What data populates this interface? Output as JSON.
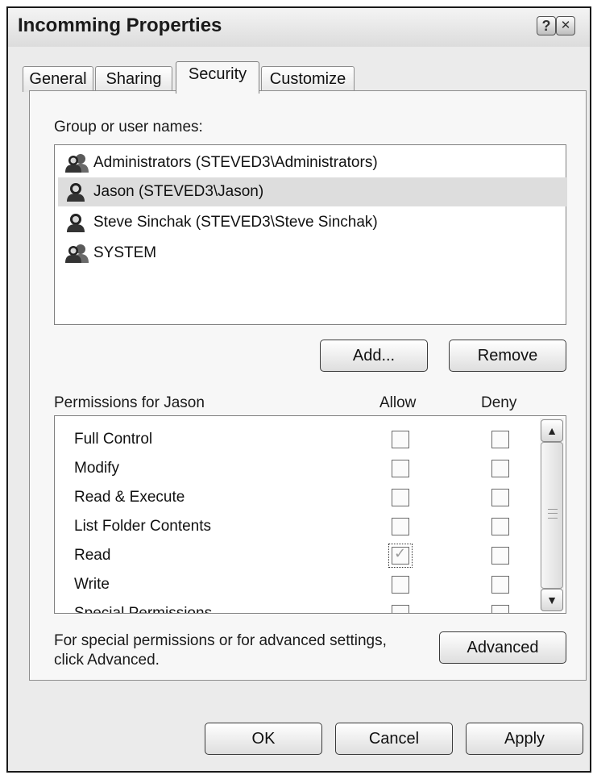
{
  "window": {
    "title": "Incomming Properties",
    "help_glyph": "?",
    "close_glyph": "✕"
  },
  "tabs": [
    {
      "label": "General"
    },
    {
      "label": "Sharing"
    },
    {
      "label": "Security"
    },
    {
      "label": "Customize"
    }
  ],
  "security": {
    "group_label": "Group or user names:",
    "users": [
      {
        "name": "Administrators (STEVED3\\Administrators)",
        "icon": "group-users-icon"
      },
      {
        "name": "Jason (STEVED3\\Jason)",
        "icon": "user-icon",
        "selected": true
      },
      {
        "name": "Steve Sinchak (STEVED3\\Steve Sinchak)",
        "icon": "user-icon"
      },
      {
        "name": "SYSTEM",
        "icon": "group-users-icon"
      }
    ],
    "add_label": "Add...",
    "remove_label": "Remove",
    "permissions_label": "Permissions for Jason",
    "allow_header": "Allow",
    "deny_header": "Deny",
    "permissions": [
      {
        "name": "Full Control",
        "allow": false,
        "deny": false
      },
      {
        "name": "Modify",
        "allow": false,
        "deny": false
      },
      {
        "name": "Read & Execute",
        "allow": false,
        "deny": false
      },
      {
        "name": "List Folder Contents",
        "allow": false,
        "deny": false
      },
      {
        "name": "Read",
        "allow": true,
        "deny": false
      },
      {
        "name": "Write",
        "allow": false,
        "deny": false
      },
      {
        "name": "Special Permissions",
        "allow": false,
        "deny": false
      }
    ],
    "advanced_text": "For special permissions or for advanced settings, click Advanced.",
    "advanced_text_line1": "For special permissions or for advanced settings,",
    "advanced_text_line2": "click Advanced.",
    "advanced_label": "Advanced"
  },
  "footer": {
    "ok_label": "OK",
    "cancel_label": "Cancel",
    "apply_label": "Apply"
  }
}
